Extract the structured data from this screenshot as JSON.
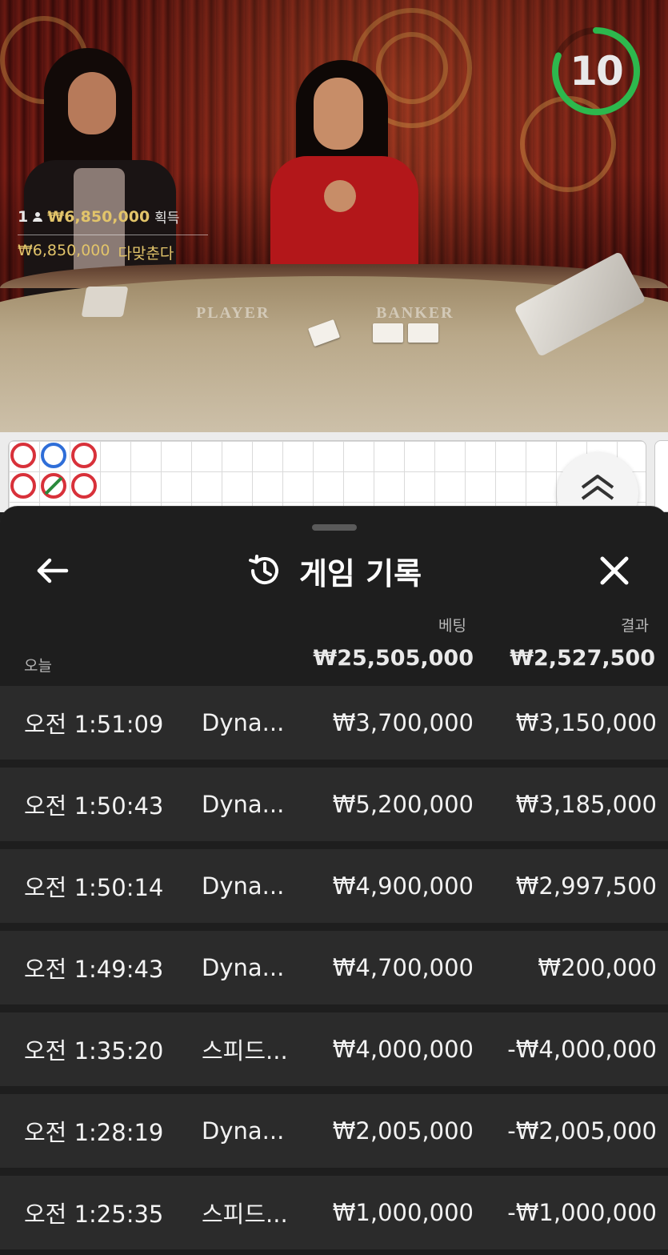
{
  "video": {
    "table_labels": {
      "player": "PLAYER",
      "banker": "BANKER"
    },
    "win_notice": {
      "winner_count": "1",
      "winner_icon": "person-icon",
      "amount": "₩6,850,000",
      "amount_label": "획득",
      "total_amount": "₩6,850,000",
      "total_label": "다맞춘다"
    },
    "timer": {
      "value": "10",
      "color": "#2db84d"
    }
  },
  "roadmap": {
    "beads": [
      "red",
      "blue",
      "red",
      "red",
      "tie",
      "red"
    ],
    "expand_icon": "double-chevron-up-icon"
  },
  "sheet": {
    "title": "게임 기록",
    "title_icon": "history-icon",
    "back_icon": "arrow-left-icon",
    "close_icon": "close-icon",
    "columns": {
      "bet": "베팅",
      "result": "결과"
    },
    "summary": {
      "label": "오늘",
      "total_bet": "₩25,505,000",
      "total_result": "₩2,527,500"
    },
    "rows": [
      {
        "time": "오전 1:51:09",
        "game": "Dyna...",
        "bet": "₩3,700,000",
        "result": "₩3,150,000"
      },
      {
        "time": "오전 1:50:43",
        "game": "Dyna...",
        "bet": "₩5,200,000",
        "result": "₩3,185,000"
      },
      {
        "time": "오전 1:50:14",
        "game": "Dyna...",
        "bet": "₩4,900,000",
        "result": "₩2,997,500"
      },
      {
        "time": "오전 1:49:43",
        "game": "Dyna...",
        "bet": "₩4,700,000",
        "result": "₩200,000"
      },
      {
        "time": "오전 1:35:20",
        "game": "스피드...",
        "bet": "₩4,000,000",
        "result": "-₩4,000,000"
      },
      {
        "time": "오전 1:28:19",
        "game": "Dyna...",
        "bet": "₩2,005,000",
        "result": "-₩2,005,000"
      },
      {
        "time": "오전 1:25:35",
        "game": "스피드...",
        "bet": "₩1,000,000",
        "result": "-₩1,000,000"
      }
    ]
  },
  "colors": {
    "accent_gold": "#e2c46a",
    "sheet_bg": "#1e1e1e",
    "row_bg": "#2b2b2b",
    "banker_red": "#d8313a",
    "player_blue": "#2f6ed8"
  }
}
